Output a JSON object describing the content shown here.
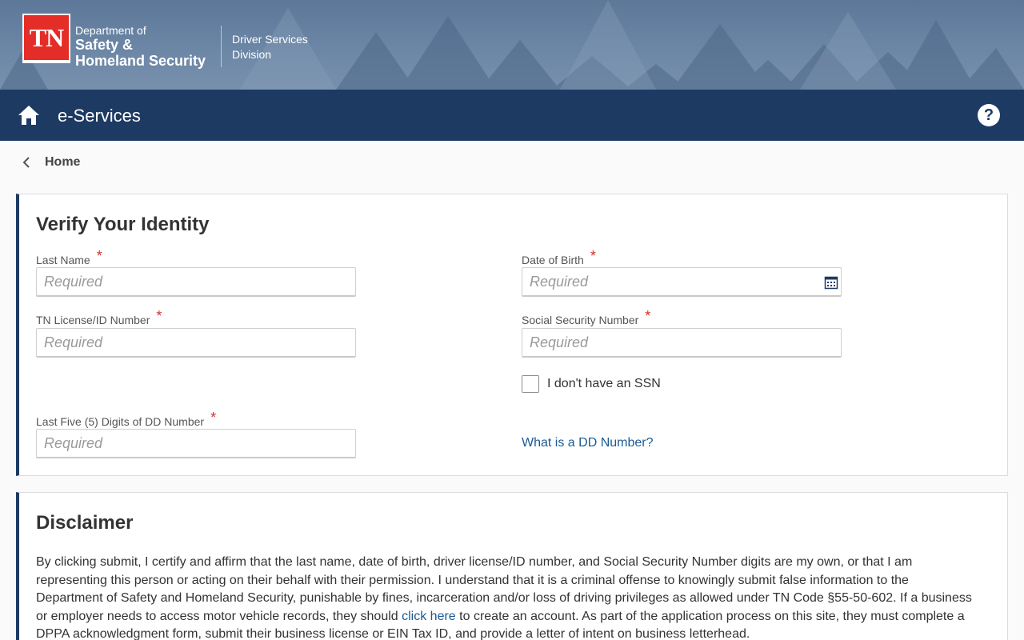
{
  "header": {
    "logo_text": "TN",
    "dept_line1": "Department of",
    "dept_line2": "Safety &",
    "dept_line3": "Homeland Security",
    "division_line1": "Driver Services",
    "division_line2": "Division"
  },
  "navbar": {
    "title": "e-Services",
    "help_symbol": "?"
  },
  "breadcrumb": {
    "label": "Home"
  },
  "verify": {
    "title": "Verify Your Identity",
    "required_mark": "*",
    "fields": {
      "last_name": {
        "label": "Last Name",
        "placeholder": "Required",
        "value": ""
      },
      "dob": {
        "label": "Date of Birth",
        "placeholder": "Required",
        "value": ""
      },
      "license": {
        "label": "TN License/ID Number",
        "placeholder": "Required",
        "value": ""
      },
      "ssn": {
        "label": "Social Security Number",
        "placeholder": "Required",
        "value": ""
      },
      "dd": {
        "label": "Last Five (5) Digits of DD Number",
        "placeholder": "Required",
        "value": ""
      }
    },
    "no_ssn_label": "I don't have an SSN",
    "no_ssn_checked": false,
    "dd_help_link": "What is a DD Number?"
  },
  "disclaimer": {
    "title": "Disclaimer",
    "text_before_link": "By clicking submit, I certify and affirm that the last name, date of birth, driver license/ID number, and Social Security Number digits are my own, or that I am representing this person or acting on their behalf with their permission. I understand that it is a criminal offense to knowingly submit false information to the Department of Safety and Homeland Security, punishable by fines, incarceration and/or loss of driving privileges as allowed under TN Code §55-50-602.     If a business or employer needs to access motor vehicle records, they should",
    "link_text": "click here",
    "text_after_link": "to create an account. As part of the application process on this site, they must complete a DPPA acknowledgment form, submit their business license or EIN Tax ID, and provide a letter of intent on business letterhead."
  },
  "colors": {
    "navbar": "#1d3a63",
    "logo_red": "#e32d26",
    "required_red": "#d0322d",
    "link_blue": "#1a5a96"
  },
  "icons": [
    "home-icon",
    "help-icon",
    "chevron-left-icon",
    "calendar-icon"
  ]
}
